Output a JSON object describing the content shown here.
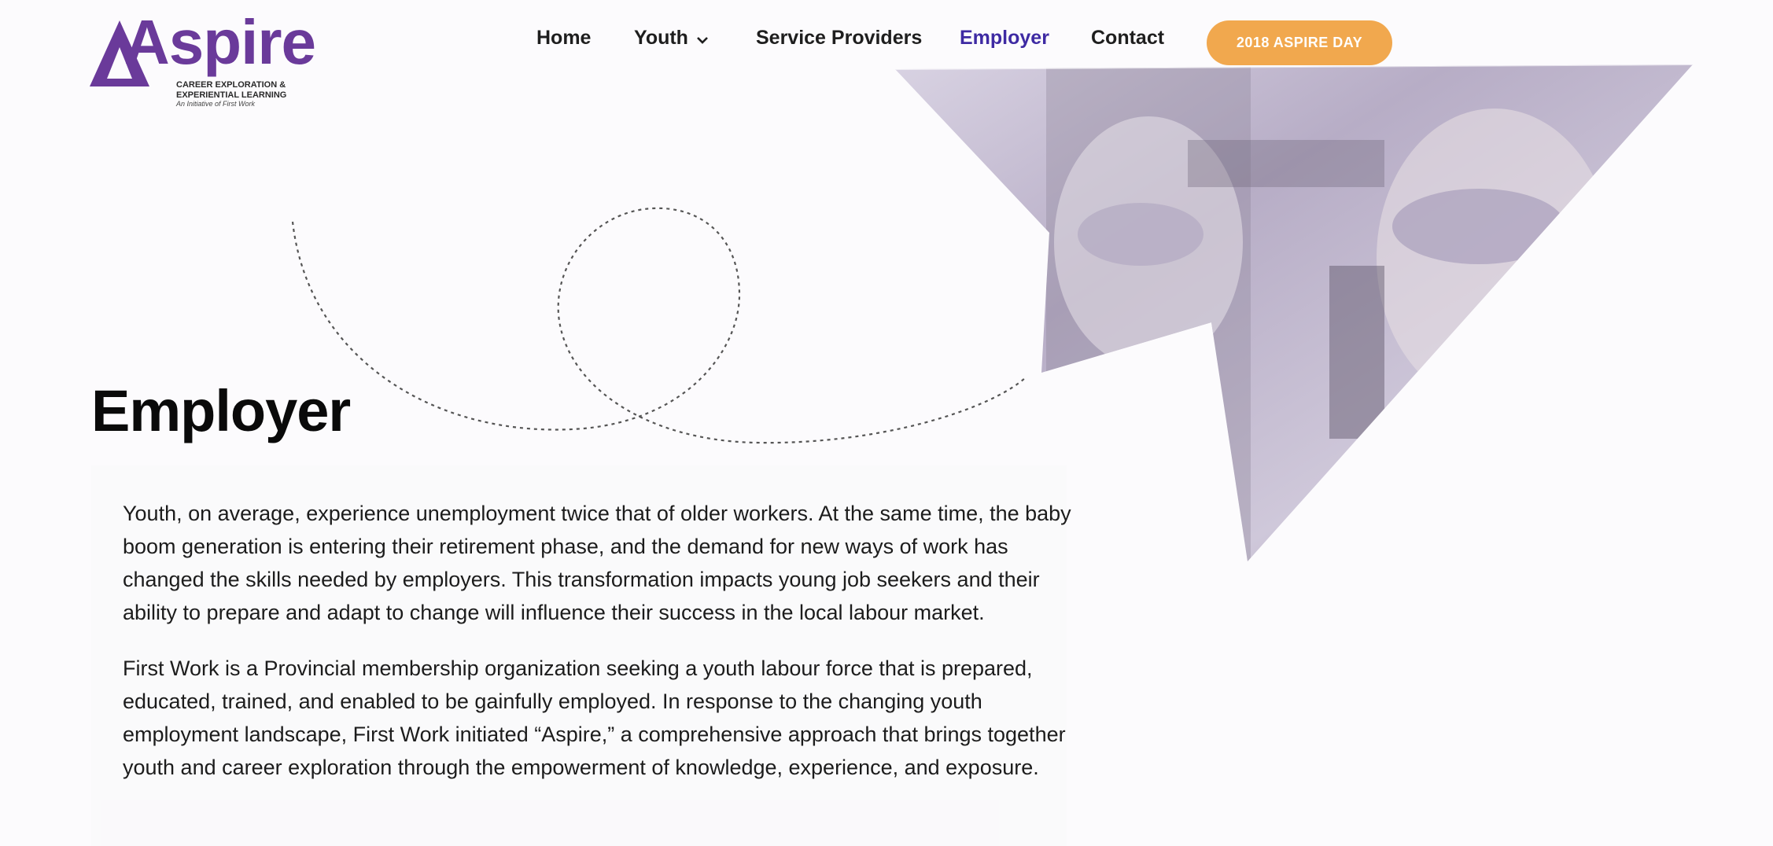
{
  "logo": {
    "wordmark": "Aspire",
    "tagline_line1": "CAREER EXPLORATION &",
    "tagline_line2": "EXPERIENTIAL LEARNING",
    "subline": "An Initiative of First Work"
  },
  "nav": {
    "items": [
      {
        "label": "Home"
      },
      {
        "label": "Youth"
      },
      {
        "label": "Service Providers"
      },
      {
        "label": "Employer"
      },
      {
        "label": "Contact"
      }
    ],
    "cta_label": "2018 ASPIRE DAY"
  },
  "page": {
    "title": "Employer",
    "paragraph_1": "Youth, on average, experience unemployment twice that of older workers. At the same time, the baby boom generation is entering their retirement phase, and the demand for new ways of work has changed the skills needed by employers. This transformation impacts young job seekers and their ability to prepare and adapt to change will influence their success in the local labour market.",
    "paragraph_2": "First Work is a Provincial membership organization seeking a youth labour force that is prepared, educated, trained, and enabled to be gainfully employed. In response to the changing youth employment landscape, First Work initiated “Aspire,” a comprehensive approach that brings together youth and career exploration through the empowerment of knowledge, experience, and exposure."
  },
  "colors": {
    "brand_purple": "#6a3a9a",
    "nav_active": "#3e2aa3",
    "cta_orange": "#f1a84e"
  }
}
